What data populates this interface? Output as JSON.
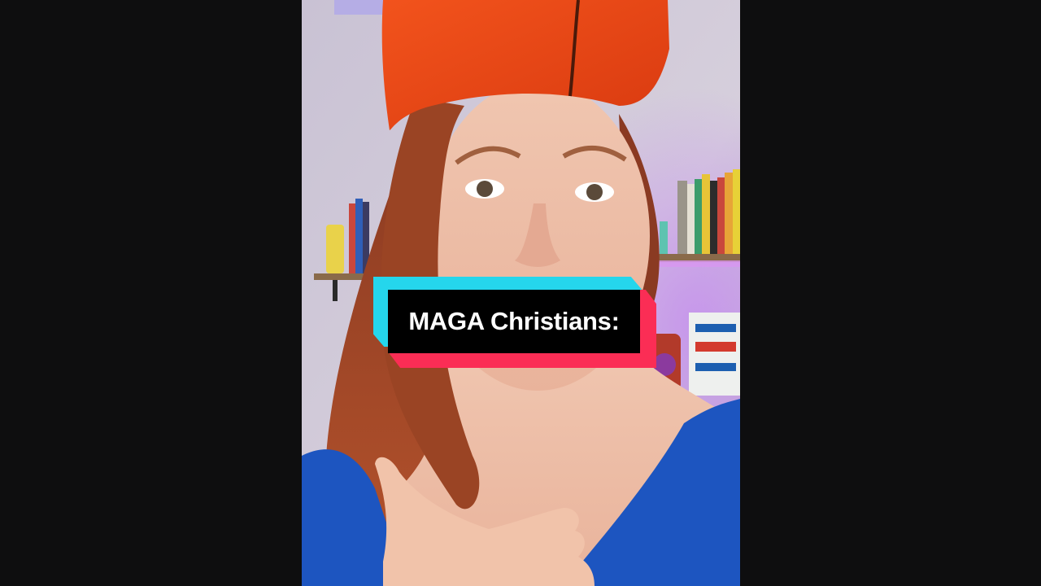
{
  "caption": {
    "text": "MAGA Christians:"
  },
  "colors": {
    "letterbox": "#0e0e0f",
    "caption_cyan": "#25d6ec",
    "caption_pink": "#fb2d55",
    "caption_bg": "#000000",
    "caption_text": "#ffffff"
  }
}
